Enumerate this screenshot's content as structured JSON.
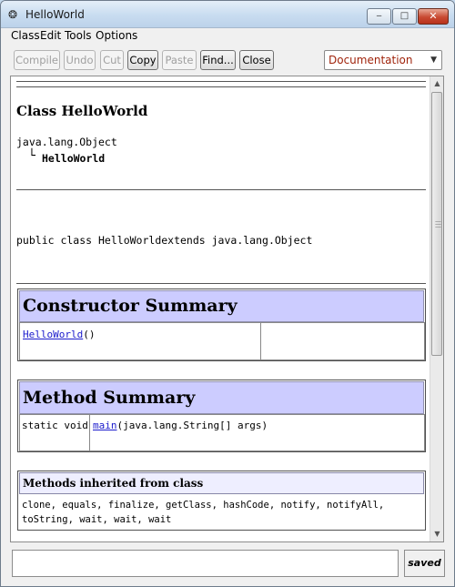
{
  "window": {
    "title": "HelloWorld",
    "app_icon_glyph": "❂",
    "minimize_glyph": "‒",
    "maximize_glyph": "□",
    "close_glyph": "✕"
  },
  "menu": [
    "Class",
    "Edit",
    "Tools",
    "Options"
  ],
  "toolbar": {
    "buttons": [
      {
        "label": "Compile",
        "enabled": false
      },
      {
        "label": "Undo",
        "enabled": false
      },
      {
        "label": "Cut",
        "enabled": false
      },
      {
        "label": "Copy",
        "enabled": true
      },
      {
        "label": "Paste",
        "enabled": false
      },
      {
        "label": "Find...",
        "enabled": true
      },
      {
        "label": "Close",
        "enabled": true
      }
    ],
    "view_select": {
      "value": "Documentation",
      "color": "#a0240c"
    }
  },
  "doc": {
    "class_heading": "Class HelloWorld",
    "hierarchy": {
      "parent": "java.lang.Object",
      "connector": "└",
      "child": "HelloWorld"
    },
    "declaration": "public class HelloWorldextends java.lang.Object",
    "constructor_summary": {
      "title": "Constructor Summary",
      "link": "HelloWorld",
      "suffix": "()"
    },
    "method_summary": {
      "title": "Method Summary",
      "modifier": "static void",
      "link": "main",
      "signature": "(java.lang.String[] args)"
    },
    "inherited": {
      "title": "Methods inherited from class",
      "line1": "clone, equals, finalize, getClass, hashCode, notify, notifyAll,",
      "line2": "toString, wait, wait, wait"
    }
  },
  "status": {
    "message": "",
    "saved_label": "saved"
  },
  "colors": {
    "summary_header_bg": "#ccccff",
    "inherited_header_bg": "#eeeeff",
    "link": "#1a1acc"
  }
}
